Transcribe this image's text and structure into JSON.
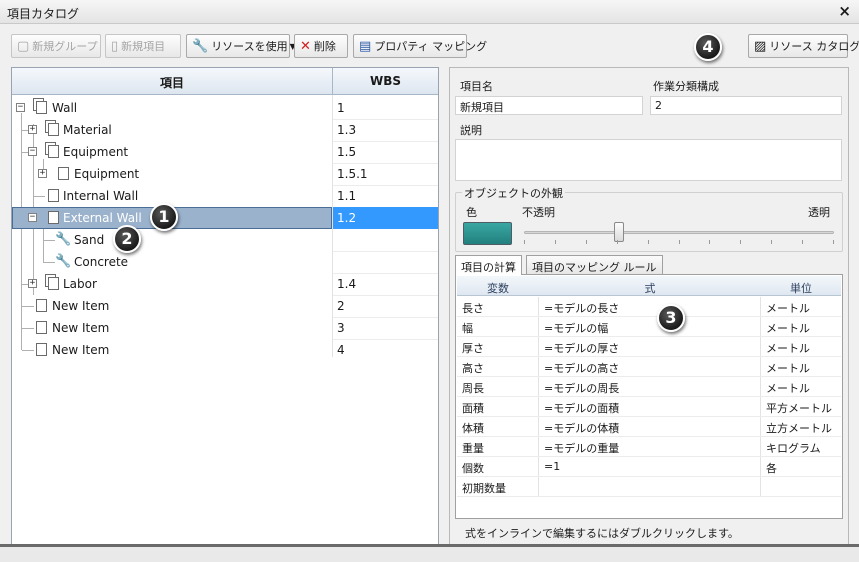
{
  "window": {
    "title": "項目カタログ",
    "close_glyph": "×"
  },
  "toolbar": {
    "new_group": "新規グループ",
    "new_item": "新規項目",
    "use_resource": "リソースを使用",
    "delete": "削除",
    "property_mapping": "プロパティ マッピング",
    "resource_catalog": "リソース カタログ"
  },
  "tree": {
    "header_item": "項目",
    "header_wbs": "WBS",
    "rows": [
      {
        "label": "Wall",
        "wbs": "1"
      },
      {
        "label": "Material",
        "wbs": "1.3"
      },
      {
        "label": "Equipment",
        "wbs": "1.5"
      },
      {
        "label": "Equipment",
        "wbs": "1.5.1"
      },
      {
        "label": "Internal Wall",
        "wbs": "1.1"
      },
      {
        "label": "External Wall",
        "wbs": "1.2"
      },
      {
        "label": "Sand",
        "wbs": ""
      },
      {
        "label": "Concrete",
        "wbs": ""
      },
      {
        "label": "Labor",
        "wbs": "1.4"
      },
      {
        "label": "New Item",
        "wbs": "2"
      },
      {
        "label": "New Item",
        "wbs": "3"
      },
      {
        "label": "New Item",
        "wbs": "4"
      }
    ]
  },
  "properties": {
    "name_label": "項目名",
    "name_value": "新規項目",
    "wbs_label": "作業分類構成",
    "wbs_value": "2",
    "description_label": "説明",
    "appearance_title": "オブジェクトの外観",
    "color_label": "色",
    "opaque_label": "不透明",
    "transparent_label": "透明",
    "swatch_color": "#2a9390",
    "transparency_fraction": 0.3
  },
  "tabs": {
    "calc": "項目の計算",
    "mapping": "項目のマッピング ルール"
  },
  "calc_table": {
    "headers": [
      "変数",
      "式",
      "単位"
    ],
    "rows": [
      [
        "長さ",
        "=モデルの長さ",
        "メートル"
      ],
      [
        "幅",
        "=モデルの幅",
        "メートル"
      ],
      [
        "厚さ",
        "=モデルの厚さ",
        "メートル"
      ],
      [
        "高さ",
        "=モデルの高さ",
        "メートル"
      ],
      [
        "周長",
        "=モデルの周長",
        "メートル"
      ],
      [
        "面積",
        "=モデルの面積",
        "平方メートル"
      ],
      [
        "体積",
        "=モデルの体積",
        "立方メートル"
      ],
      [
        "重量",
        "=モデルの重量",
        "キログラム"
      ],
      [
        "個数",
        "=1",
        "各"
      ],
      [
        "初期数量",
        "",
        ""
      ]
    ],
    "hint": "式をインラインで編集するにはダブルクリックします。"
  },
  "badges": [
    "1",
    "2",
    "3",
    "4"
  ]
}
